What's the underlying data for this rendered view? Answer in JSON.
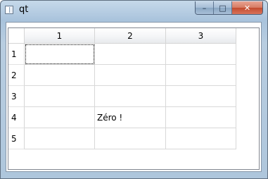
{
  "window": {
    "title": "qt",
    "minimize_glyph": "–",
    "maximize_glyph": "□",
    "close_glyph": "✕"
  },
  "table": {
    "column_headers": [
      "1",
      "2",
      "3"
    ],
    "row_headers": [
      "1",
      "2",
      "3",
      "4",
      "5"
    ],
    "cells": [
      [
        "",
        "",
        ""
      ],
      [
        "",
        "",
        ""
      ],
      [
        "",
        "",
        ""
      ],
      [
        "",
        "Zéro !",
        ""
      ],
      [
        "",
        "",
        ""
      ]
    ],
    "current_cell": {
      "row": 1,
      "column": 1
    }
  }
}
